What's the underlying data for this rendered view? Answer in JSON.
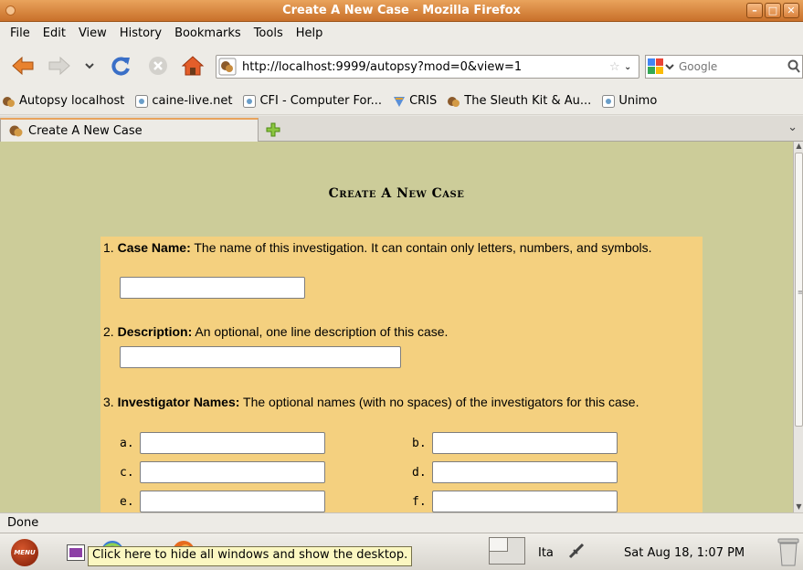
{
  "window": {
    "title": "Create A New Case - Mozilla Firefox"
  },
  "menubar": {
    "items": [
      {
        "label": "File"
      },
      {
        "label": "Edit"
      },
      {
        "label": "View"
      },
      {
        "label": "History"
      },
      {
        "label": "Bookmarks"
      },
      {
        "label": "Tools"
      },
      {
        "label": "Help"
      }
    ]
  },
  "navbar": {
    "url": "http://localhost:9999/autopsy?mod=0&view=1",
    "search_placeholder": "Google"
  },
  "bookmarks": [
    {
      "label": "Autopsy localhost",
      "icon": "autopsy-dog-icon"
    },
    {
      "label": "caine-live.net",
      "icon": "page-icon"
    },
    {
      "label": "CFI - Computer For...",
      "icon": "page-icon"
    },
    {
      "label": "CRIS",
      "icon": "cris-icon"
    },
    {
      "label": "The Sleuth Kit & Au...",
      "icon": "autopsy-dog-icon"
    },
    {
      "label": "Unimo",
      "icon": "page-icon"
    }
  ],
  "tab": {
    "label": "Create A New Case"
  },
  "page": {
    "title": "Create A New Case",
    "q1": {
      "num": "1. ",
      "bold": "Case Name:",
      "text": " The name of this investigation. It can contain only letters, numbers, and symbols.",
      "value": ""
    },
    "q2": {
      "num": "2. ",
      "bold": "Description:",
      "text": " An optional, one line description of this case.",
      "value": ""
    },
    "q3": {
      "num": "3. ",
      "bold": "Investigator Names:",
      "text": " The optional names (with no spaces) of the investigators for this case.",
      "labels": [
        "a.",
        "b.",
        "c.",
        "d.",
        "e.",
        "f."
      ]
    }
  },
  "status": {
    "text": "Done"
  },
  "panel": {
    "menu_label": "MENU",
    "tooltip": "Click here to hide all windows and show the desktop.",
    "keyboard": "Ita",
    "clock": "Sat Aug 18,  1:07 PM"
  }
}
